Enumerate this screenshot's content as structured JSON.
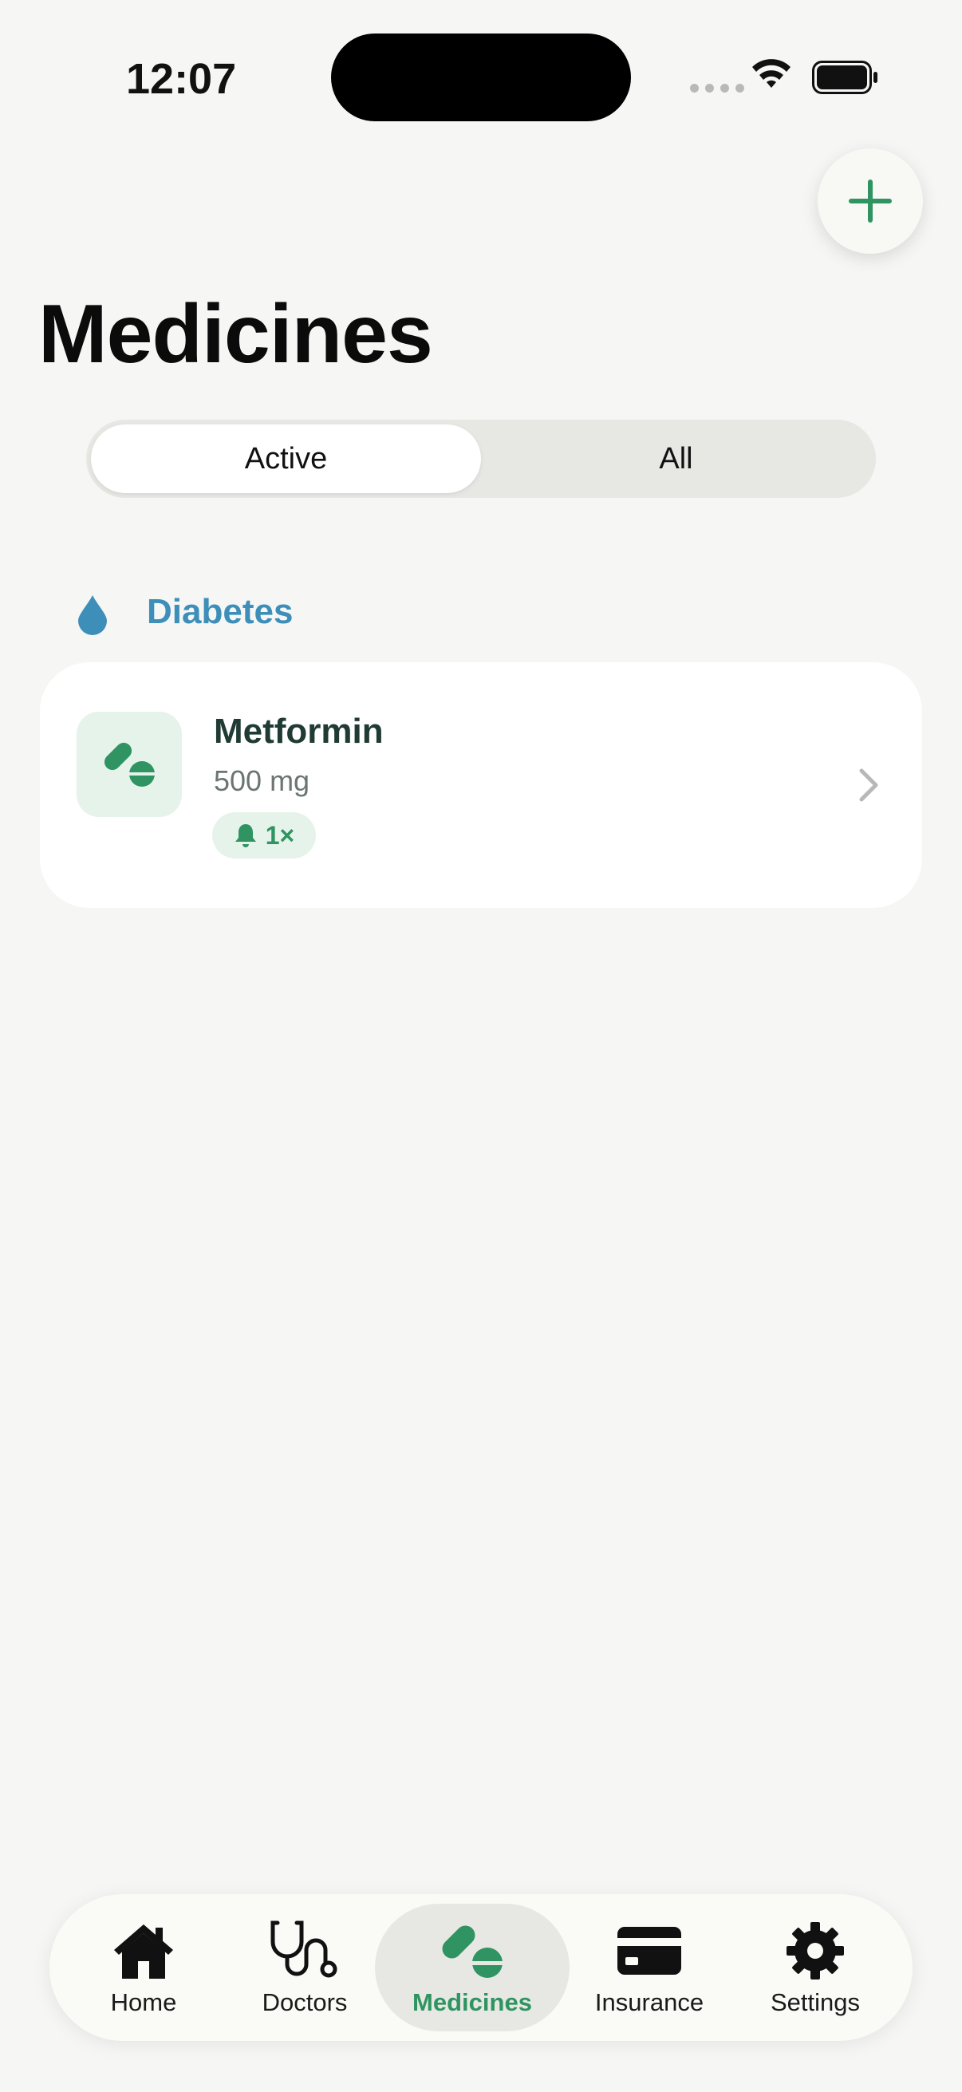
{
  "status_bar": {
    "time": "12:07"
  },
  "header": {
    "title": "Medicines",
    "add_icon": "plus-icon"
  },
  "segmented": {
    "options": [
      "Active",
      "All"
    ],
    "selected": "Active"
  },
  "category": {
    "label": "Diabetes",
    "icon": "drop-icon",
    "color": "#3D8FBA"
  },
  "medicines": [
    {
      "name": "Metformin",
      "dose": "500 mg",
      "reminder": "1×",
      "icon": "pills-icon"
    }
  ],
  "tabbar": {
    "items": [
      {
        "label": "Home",
        "icon": "house-icon"
      },
      {
        "label": "Doctors",
        "icon": "stethoscope-icon"
      },
      {
        "label": "Medicines",
        "icon": "pills-icon"
      },
      {
        "label": "Insurance",
        "icon": "card-icon"
      },
      {
        "label": "Settings",
        "icon": "gear-icon"
      }
    ],
    "active": "Medicines"
  },
  "colors": {
    "accent": "#2F9461",
    "background": "#F6F6F4",
    "card": "#FFFFFF"
  }
}
